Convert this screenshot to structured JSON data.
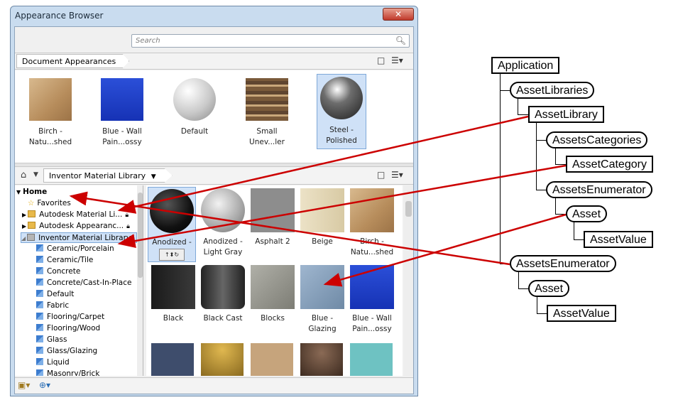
{
  "window": {
    "title": "Appearance Browser",
    "close_label": "✕",
    "search_placeholder": "Search"
  },
  "document_appearances": {
    "breadcrumb": "Document Appearances",
    "items": [
      {
        "label": "Birch - Natu...shed"
      },
      {
        "label": "Blue - Wall Pain...ossy"
      },
      {
        "label": "Default"
      },
      {
        "label": "Small Unev...ler"
      },
      {
        "label": "Steel - Polished"
      }
    ]
  },
  "library_bar": {
    "library_name": "Inventor Material Library"
  },
  "tree": {
    "home": "Home",
    "favorites": "Favorites",
    "autodesk_material": "Autodesk Material Li...",
    "autodesk_appearance": "Autodesk Appearanc...",
    "inventor_library": "Inventor Material Library",
    "categories": [
      "Ceramic/Porcelain",
      "Ceramic/Tile",
      "Concrete",
      "Concrete/Cast-In-Place",
      "Default",
      "Fabric",
      "Flooring/Carpet",
      "Flooring/Wood",
      "Glass",
      "Glass/Glazing",
      "Liquid",
      "Masonry/Brick"
    ]
  },
  "grid_items": [
    {
      "label": "Anodized -"
    },
    {
      "label": "Anodized - Light Gray"
    },
    {
      "label": "Asphalt 2"
    },
    {
      "label": "Beige"
    },
    {
      "label": "Birch - Natu...shed"
    },
    {
      "label": "Black"
    },
    {
      "label": "Black Cast"
    },
    {
      "label": "Blocks"
    },
    {
      "label": "Blue - Glazing"
    },
    {
      "label": "Blue - Wall Pain...ossy"
    }
  ],
  "hierarchy": {
    "application": "Application",
    "asset_libraries": "AssetLibraries",
    "asset_library": "AssetLibrary",
    "assets_categories": "AssetsCategories",
    "asset_category": "AssetCategory",
    "assets_enumerator_1": "AssetsEnumerator",
    "asset_1": "Asset",
    "asset_value_1": "AssetValue",
    "assets_enumerator_2": "AssetsEnumerator",
    "asset_2": "Asset",
    "asset_value_2": "AssetValue"
  },
  "colors": {
    "arrow": "#cc0000",
    "selection": "#cfe1f7"
  },
  "icons": [
    "search-icon",
    "close-icon",
    "home-icon",
    "star-icon",
    "folder-icon",
    "lock-icon",
    "view-toggle-icon",
    "list-view-icon",
    "chevron-down-icon"
  ]
}
